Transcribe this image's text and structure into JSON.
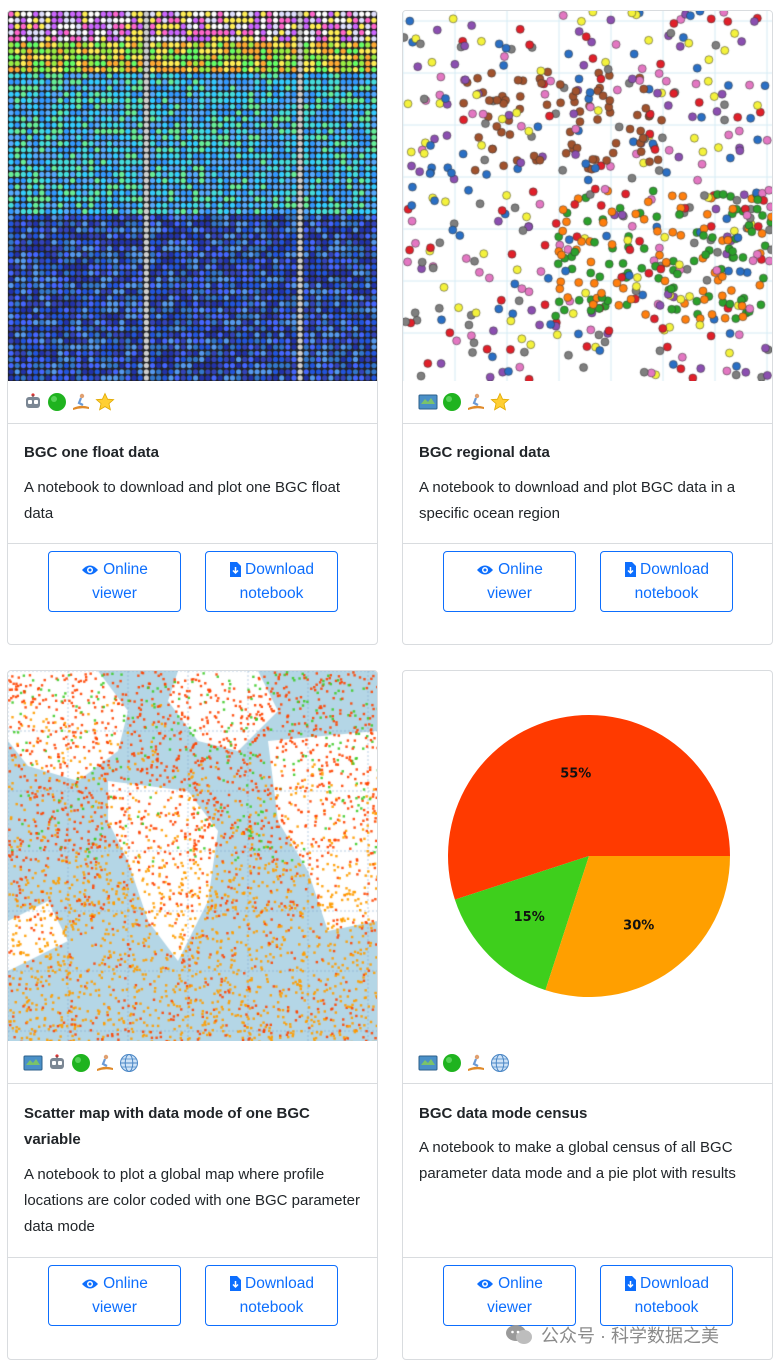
{
  "cards": [
    {
      "title": "BGC one float data",
      "description": "A notebook to download and plot one BGC float data",
      "badges": [
        "robot-icon",
        "green-circle-icon",
        "surfer-icon",
        "star-icon"
      ],
      "online_viewer": "Online viewer",
      "download": "Download notebook"
    },
    {
      "title": "BGC regional data",
      "description": "A notebook to download and plot BGC data in a specific ocean region",
      "badges": [
        "map-icon",
        "green-circle-icon",
        "surfer-icon",
        "star-icon"
      ],
      "online_viewer": "Online viewer",
      "download": "Download notebook"
    },
    {
      "title": "Scatter map with data mode of one BGC variable",
      "description": "A notebook to plot a global map where profile locations are color coded with one BGC parameter data mode",
      "badges": [
        "map-icon",
        "robot-icon",
        "green-circle-icon",
        "surfer-icon",
        "globe-icon"
      ],
      "online_viewer": "Online viewer",
      "download": "Download notebook"
    },
    {
      "title": "BGC data mode census",
      "description": "A notebook to make a global census of all BGC parameter data mode and a pie plot with results",
      "badges": [
        "map-icon",
        "green-circle-icon",
        "surfer-icon",
        "globe-icon"
      ],
      "online_viewer": "Online viewer",
      "download": "Download notebook"
    }
  ],
  "pie": {
    "slices": [
      {
        "label": "55%",
        "value": 55,
        "color": "#ff3a00"
      },
      {
        "label": "15%",
        "value": 15,
        "color": "#3ecf1c"
      },
      {
        "label": "30%",
        "value": 30,
        "color": "#ff9f00"
      }
    ]
  },
  "colors": {
    "primary": "#0d6efd",
    "border": "#d9dcdf",
    "ocean": "#b4d6e6",
    "land": "#ffffff"
  },
  "watermark": "公众号 · 科学数据之美"
}
